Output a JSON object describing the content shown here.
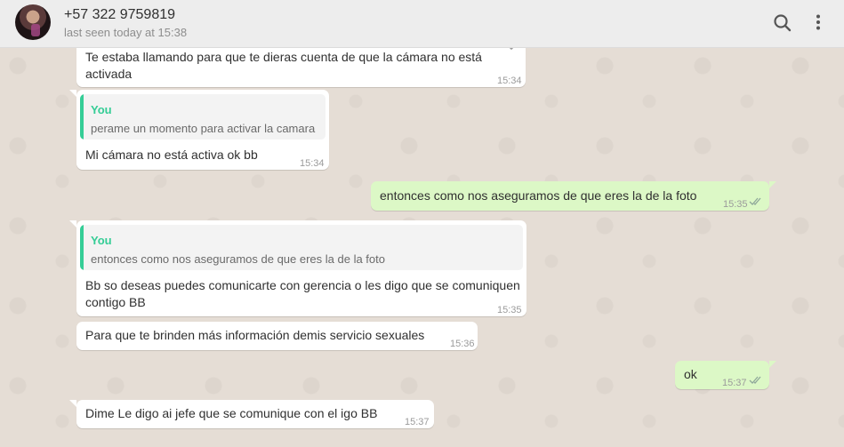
{
  "header": {
    "contact_name": "+57 322 9759819",
    "status": "last seen today at 15:38",
    "search_icon": "search-icon",
    "menu_icon": "more-vertical-icon"
  },
  "colors": {
    "incoming_bubble": "#ffffff",
    "outgoing_bubble": "#dcf8c6",
    "quote_accent": "#35cd96",
    "read_ticks": "#4fc3f7"
  },
  "messages": [
    {
      "direction": "incoming",
      "text": "Te estaba llamando para que te dieras cuenta de que la cámara no está\nactivada",
      "time": "15:34"
    },
    {
      "direction": "incoming",
      "quote_author": "You",
      "quote_text": "perame un momento para activar la camara",
      "text": "Mi cámara no está activa ok bb",
      "time": "15:34"
    },
    {
      "direction": "outgoing",
      "text": "entonces como nos aseguramos de que eres la de la foto",
      "time": "15:35"
    },
    {
      "direction": "incoming",
      "quote_author": "You",
      "quote_text": "entonces como nos aseguramos de que eres la de la foto",
      "text": "Bb so deseas puedes comunicarte con gerencia o les digo que se comuniquen\ncontigo BB",
      "time": "15:35"
    },
    {
      "direction": "incoming",
      "text": "Para que te brinden más información demis servicio sexuales",
      "time": "15:36"
    },
    {
      "direction": "outgoing",
      "text": "ok",
      "time": "15:37"
    },
    {
      "direction": "incoming",
      "text": "Dime Le digo ai jefe que se comunique con el igo BB",
      "time": "15:37"
    }
  ]
}
